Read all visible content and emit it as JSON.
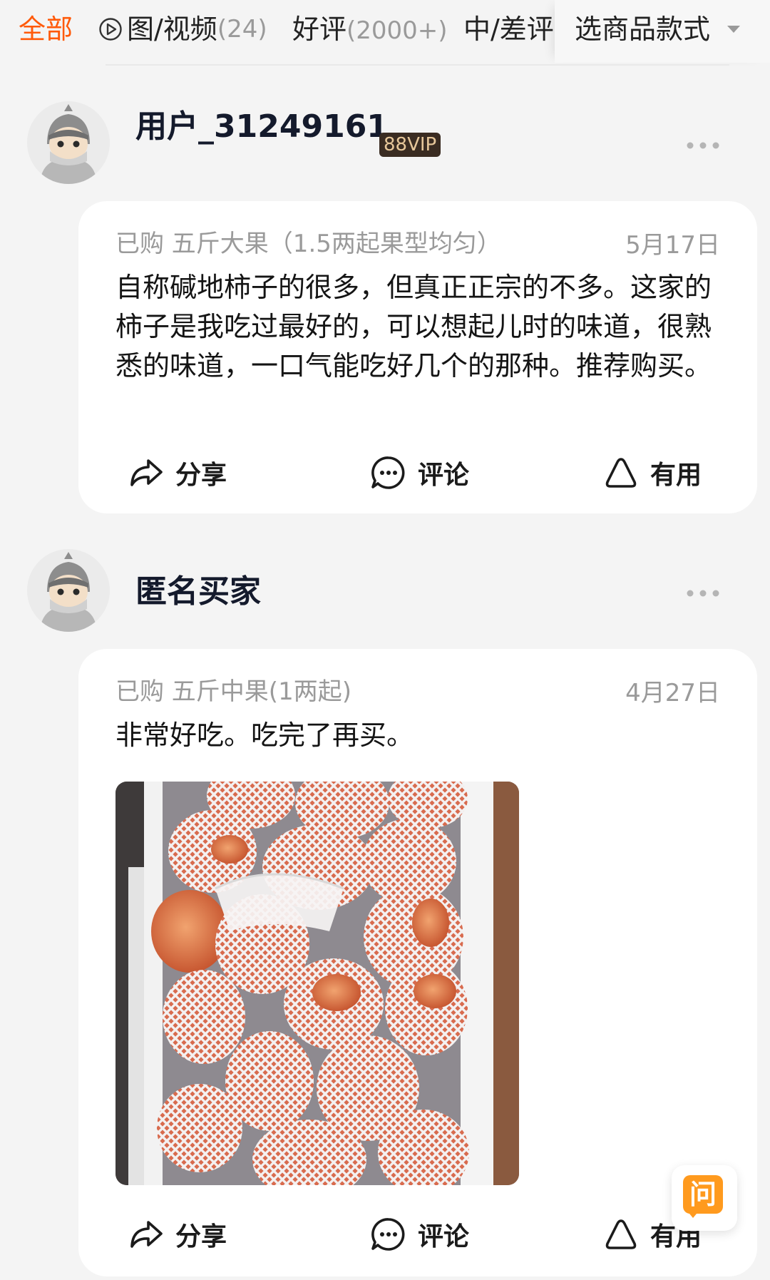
{
  "filter_bar": {
    "tabs": [
      {
        "label": "全部",
        "count": ""
      },
      {
        "label": "图/视频",
        "count": "(24)"
      },
      {
        "label": "好评",
        "count": "(2000+)"
      },
      {
        "label": "中/差评",
        "count": ""
      }
    ],
    "sku_select_label": "选商品款式"
  },
  "reviews": [
    {
      "username": "用户_31249161",
      "badge": "88VIP",
      "purchase": "已购 五斤大果（1.5两起果型均匀）",
      "date": "5月17日",
      "content": "自称碱地柿子的很多，但真正正宗的不多。这家的柿子是我吃过最好的，可以想起儿时的味道，很熟悉的味道，一口气能吃好几个的那种。推荐购买。",
      "has_photo": false
    },
    {
      "username": "匿名买家",
      "badge": "",
      "purchase": "已购 五斤中果(1两起)",
      "date": "4月27日",
      "content": "非常好吃。吃完了再买。",
      "has_photo": true
    }
  ],
  "actions": {
    "share": "分享",
    "comment": "评论",
    "useful": "有用"
  },
  "ask_button_label": "问",
  "colors": {
    "accent": "#ff5a0a",
    "ask": "#ff9a1e",
    "vip_bg": "#3a2c22",
    "vip_text": "#e7c79a"
  },
  "icons": [
    "play-circle-icon",
    "caret-down-icon",
    "more-icon",
    "share-icon",
    "comment-icon",
    "useful-icon",
    "avatar-icon"
  ]
}
